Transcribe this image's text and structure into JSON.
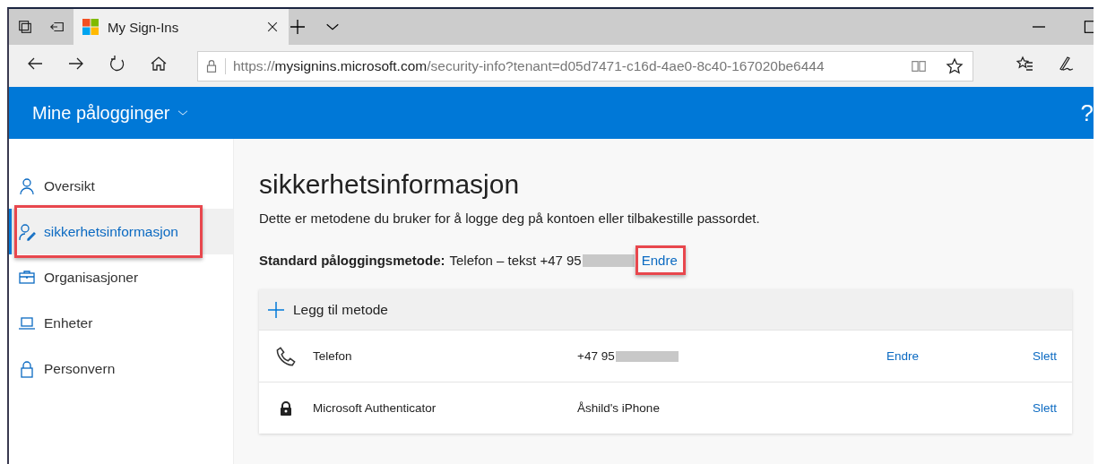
{
  "browser": {
    "tab_title": "My Sign-Ins",
    "url": {
      "scheme": "https://",
      "host": "mysignins.microsoft.com",
      "path": "/security-info?tenant=d05d7471-c16d-4ae0-8c40-167020be6444"
    }
  },
  "header": {
    "title": "Mine pålogginger",
    "help": "?"
  },
  "sidebar": {
    "items": [
      {
        "label": "Oversikt",
        "kind": "person",
        "selected": false,
        "highlighted": false
      },
      {
        "label": "sikkerhetsinformasjon",
        "kind": "person-pen",
        "selected": true,
        "highlighted": true
      },
      {
        "label": "Organisasjoner",
        "kind": "briefcase",
        "selected": false,
        "highlighted": false
      },
      {
        "label": "Enheter",
        "kind": "laptop",
        "selected": false,
        "highlighted": false
      },
      {
        "label": "Personvern",
        "kind": "lock",
        "selected": false,
        "highlighted": false
      }
    ]
  },
  "main": {
    "title": "sikkerhetsinformasjon",
    "description": "Dette er metodene du bruker for å logge deg på kontoen eller tilbakestille passordet.",
    "default_method": {
      "label": "Standard påloggingsmetode:",
      "value": "Telefon – tekst +47 95",
      "redacted": true,
      "action": "Endre",
      "highlighted": true
    },
    "add_method": "Legg til metode",
    "methods": [
      {
        "kind": "phone",
        "name": "Telefon",
        "value": "+47 95",
        "redacted": true,
        "change": "Endre",
        "delete": "Slett"
      },
      {
        "kind": "authenticator",
        "name": "Microsoft Authenticator",
        "value": "Åshild's iPhone",
        "redacted": false,
        "delete": "Slett"
      }
    ]
  }
}
